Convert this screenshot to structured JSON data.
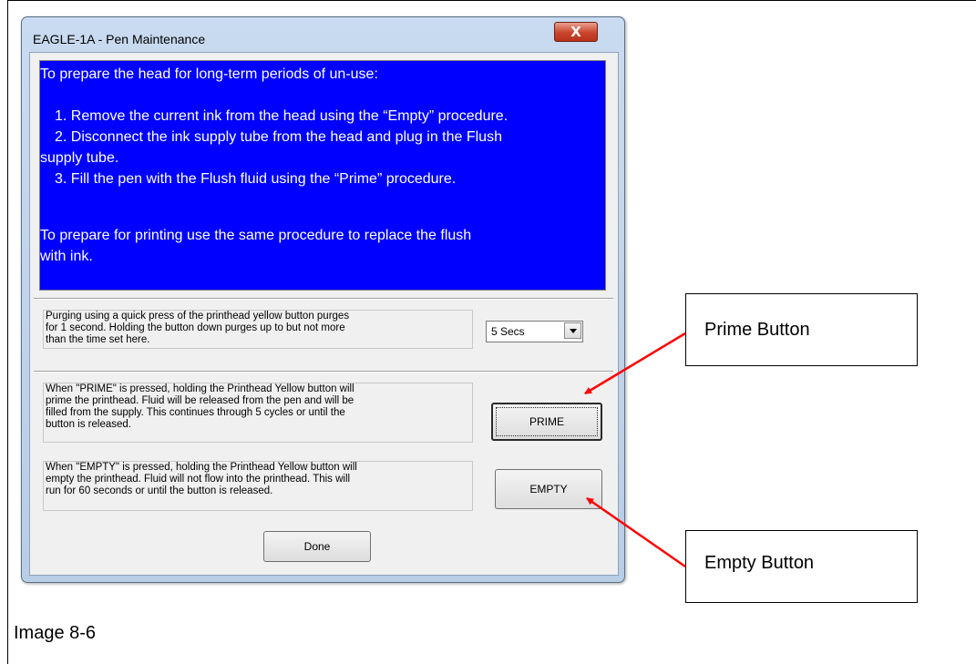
{
  "window": {
    "title": "EAGLE-1A - Pen Maintenance",
    "close_label": "X"
  },
  "instructions": {
    "lines": [
      "To prepare the head for long-term periods of un-use:",
      "1. Remove the current ink from the head using the “Empty” procedure.",
      "2. Disconnect the ink supply tube from the head and plug in the Flush",
      "supply tube.",
      "3. Fill the pen with the Flush fluid using the “Prime” procedure.",
      "To prepare for printing use the same procedure to replace the flush",
      "with ink."
    ],
    "background_color": "#0000ff",
    "text_color": "#ffffff"
  },
  "purge": {
    "lines": [
      "Purging using a quick press of the printhead yellow button purges",
      "for 1 second.  Holding the button down purges up to but not more",
      "than the time set here."
    ],
    "duration_selected": "5 Secs"
  },
  "prime": {
    "lines": [
      "When \"PRIME\" is pressed, holding the Printhead Yellow button will",
      "prime the printhead. Fluid will be released from the pen and will be",
      "filled from the supply.  This continues through 5 cycles or until the",
      "button is released."
    ],
    "button_label": "PRIME"
  },
  "empty": {
    "lines": [
      "When \"EMPTY\" is pressed, holding the Printhead Yellow button will",
      "empty the printhead. Fluid will not flow into the printhead. This will",
      "run for 60 seconds or until the button is released."
    ],
    "button_label": "EMPTY"
  },
  "done_label": "Done",
  "annotations": {
    "prime_callout": "Prime Button",
    "empty_callout": "Empty Button",
    "arrow_color": "#ff0000"
  },
  "caption": "Image 8-6"
}
